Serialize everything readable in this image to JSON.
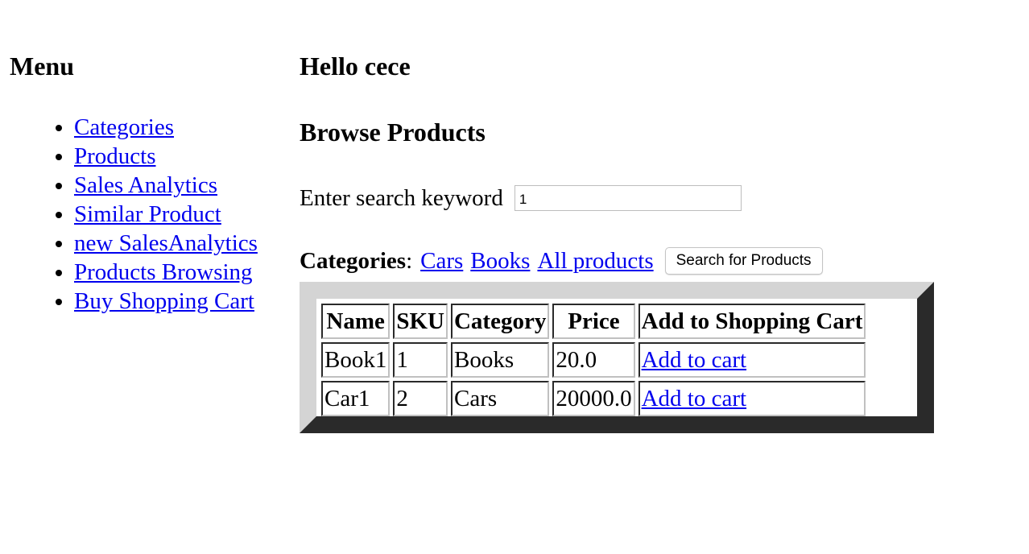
{
  "sidebar": {
    "title": "Menu",
    "items": [
      {
        "label": "Categories"
      },
      {
        "label": "Products"
      },
      {
        "label": "Sales Analytics"
      },
      {
        "label": "Similar Product"
      },
      {
        "label": "new SalesAnalytics"
      },
      {
        "label": "Products Browsing"
      },
      {
        "label": "Buy Shopping Cart"
      }
    ]
  },
  "main": {
    "greeting": "Hello cece",
    "page_title": "Browse Products",
    "search": {
      "label": "Enter search keyword",
      "value": "1"
    },
    "categories": {
      "label": "Categories",
      "separator": ":",
      "links": [
        "Cars",
        "Books",
        "All products"
      ],
      "button_label": "Search for Products"
    },
    "table": {
      "headers": [
        "Name",
        "SKU",
        "Category",
        "Price",
        "Add to Shopping Cart"
      ],
      "rows": [
        {
          "name": "Book1",
          "sku": "1",
          "category": "Books",
          "price": "20.0",
          "action": "Add to cart"
        },
        {
          "name": "Car1",
          "sku": "2",
          "category": "Cars",
          "price": "20000.0",
          "action": "Add to cart"
        }
      ]
    }
  },
  "colors": {
    "link": "#0000ee",
    "table_frame_light": "#d4d4d4",
    "table_frame_dark": "#2a2a2a"
  }
}
